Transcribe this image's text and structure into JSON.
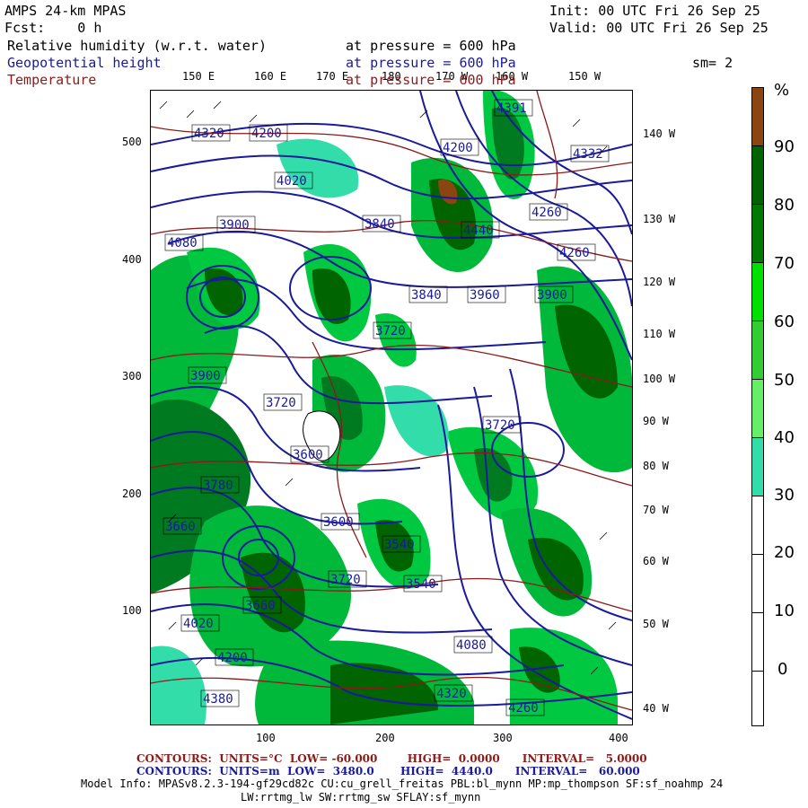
{
  "header": {
    "model": "AMPS 24-km MPAS",
    "fcst_label": "Fcst:",
    "fcst_value": "0 h",
    "init_label": "Init:",
    "init_value": "00 UTC Fri 26 Sep 25",
    "valid_label": "Valid:",
    "valid_value": "00 UTC Fri 26 Sep 25",
    "field1": "Relative humidity (w.r.t. water)",
    "field2": "Geopotential height",
    "field3": "Temperature",
    "pressure_prefix": "at pressure =",
    "pressure_value": "600 hPa",
    "smoothing": "sm= 2"
  },
  "axes": {
    "y_ticks": [
      "500",
      "400",
      "300",
      "200",
      "100"
    ],
    "x_ticks": [
      "100",
      "200",
      "300",
      "400"
    ],
    "lon_top": [
      "150 E",
      "160 E",
      "170 E",
      "180",
      "170 W",
      "160 W",
      "150 W"
    ],
    "lon_right": [
      "140 W",
      "130 W",
      "120 W",
      "110 W",
      "100 W",
      "90 W",
      "80 W",
      "70 W",
      "60 W",
      "50 W",
      "40 W"
    ]
  },
  "colorbar": {
    "unit": "%",
    "labels": [
      "90",
      "80",
      "70",
      "60",
      "50",
      "40",
      "30",
      "20",
      "10",
      "0"
    ],
    "colors": [
      "#8b4513",
      "#006400",
      "#007a00",
      "#00a800",
      "#00e600",
      "#33cc33",
      "#66ee66",
      "#33ddaa",
      "#ffffff",
      "#ffffff",
      "#ffffff",
      "#ffffff"
    ]
  },
  "contour_labels": [
    "4320",
    "4200",
    "4391",
    "4332",
    "4020",
    "4200",
    "4440",
    "4260",
    "4080",
    "3900",
    "3840",
    "4260",
    "3960",
    "3840",
    "3900",
    "3720",
    "3900",
    "3720",
    "3600",
    "3720",
    "3780",
    "3660",
    "3600",
    "3540",
    "3720",
    "3540",
    "3660",
    "4020",
    "4080",
    "4200",
    "4380",
    "4320",
    "4260"
  ],
  "footer": {
    "line1_label": "CONTOURS:",
    "line1_units": "UNITS=°C",
    "line1_low": "LOW= -60.000",
    "line1_high": "HIGH=  0.0000",
    "line1_interval": "INTERVAL=   5.0000",
    "line2_label": "CONTOURS:",
    "line2_units": "UNITS=m",
    "line2_low": "LOW=  3480.0",
    "line2_high": "HIGH=  4440.0",
    "line2_interval": "INTERVAL=   60.000",
    "model_info": "Model Info: MPASv8.2.3-194-gf29cd82c CU:cu_grell_freitas PBL:bl_mynn MP:mp_thompson SF:sf_noahmp 24",
    "model_info2": "LW:rrtmg_lw SW:rrtmg_sw SFLAY:sf_mynn"
  },
  "colors": {
    "temperature": "#8b1a1a",
    "height": "#1a1a9a",
    "rh_light": "#33ddaa",
    "rh_mid": "#00cc33",
    "rh_dark": "#006400",
    "rh_brown": "#8b4513"
  }
}
